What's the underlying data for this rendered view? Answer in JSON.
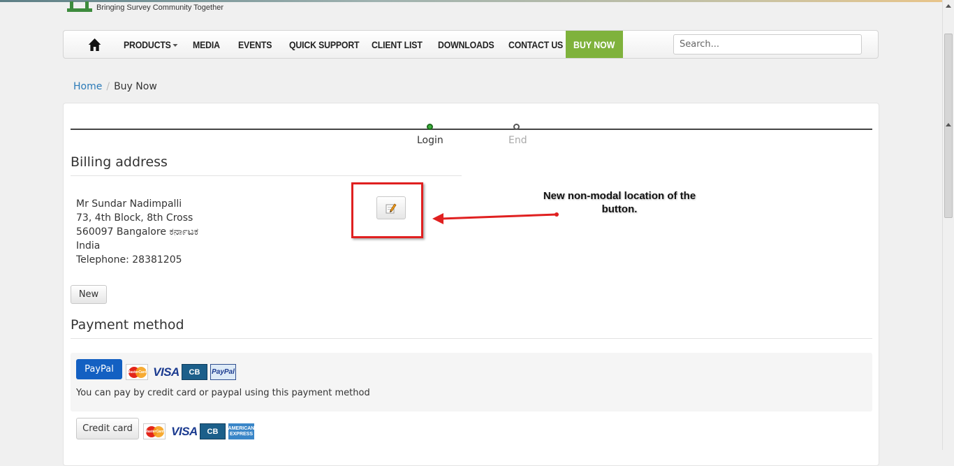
{
  "header": {
    "tagline": "Bringing Survey Community Together"
  },
  "nav": {
    "items": [
      {
        "label": "PRODUCTS",
        "dropdown": true
      },
      {
        "label": "MEDIA"
      },
      {
        "label": "EVENTS"
      },
      {
        "label": "QUICK SUPPORT"
      },
      {
        "label": "CLIENT LIST"
      },
      {
        "label": "DOWNLOADS"
      },
      {
        "label": "CONTACT US"
      }
    ],
    "buy_now": "BUY NOW",
    "search_placeholder": "Search...",
    "home_icon": "home-icon"
  },
  "breadcrumb": {
    "home": "Home",
    "current": "Buy Now"
  },
  "steps": [
    {
      "label": "Login",
      "state": "active"
    },
    {
      "label": "End",
      "state": "inactive"
    }
  ],
  "billing": {
    "title": "Billing address",
    "lines": [
      "Mr Sundar Nadimpalli",
      "73, 4th Block, 8th Cross",
      "560097 Bangalore ಕರ್ನಾಟಕ",
      "India",
      "Telephone: 28381205"
    ],
    "edit_icon": "edit-pencil-icon",
    "new_button": "New"
  },
  "annotation": {
    "text": "New non-modal location of the button."
  },
  "payment": {
    "title": "Payment method",
    "paypal_button": "PayPal",
    "paypal_description": "You can pay by credit card or paypal using this payment method",
    "credit_card_button": "Credit card",
    "card_logos": {
      "mastercard": "MasterCard",
      "visa": "VISA",
      "cb": "CB",
      "paypal": "PayPal",
      "amex_line1": "AMERICAN",
      "amex_line2": "EXPRESS"
    }
  },
  "colors": {
    "buy_now_bg": "#7fb23c",
    "link": "#2a7ab8",
    "paypal_button": "#1360c2",
    "highlight": "#e02020",
    "active_step": "#3cb43c"
  }
}
